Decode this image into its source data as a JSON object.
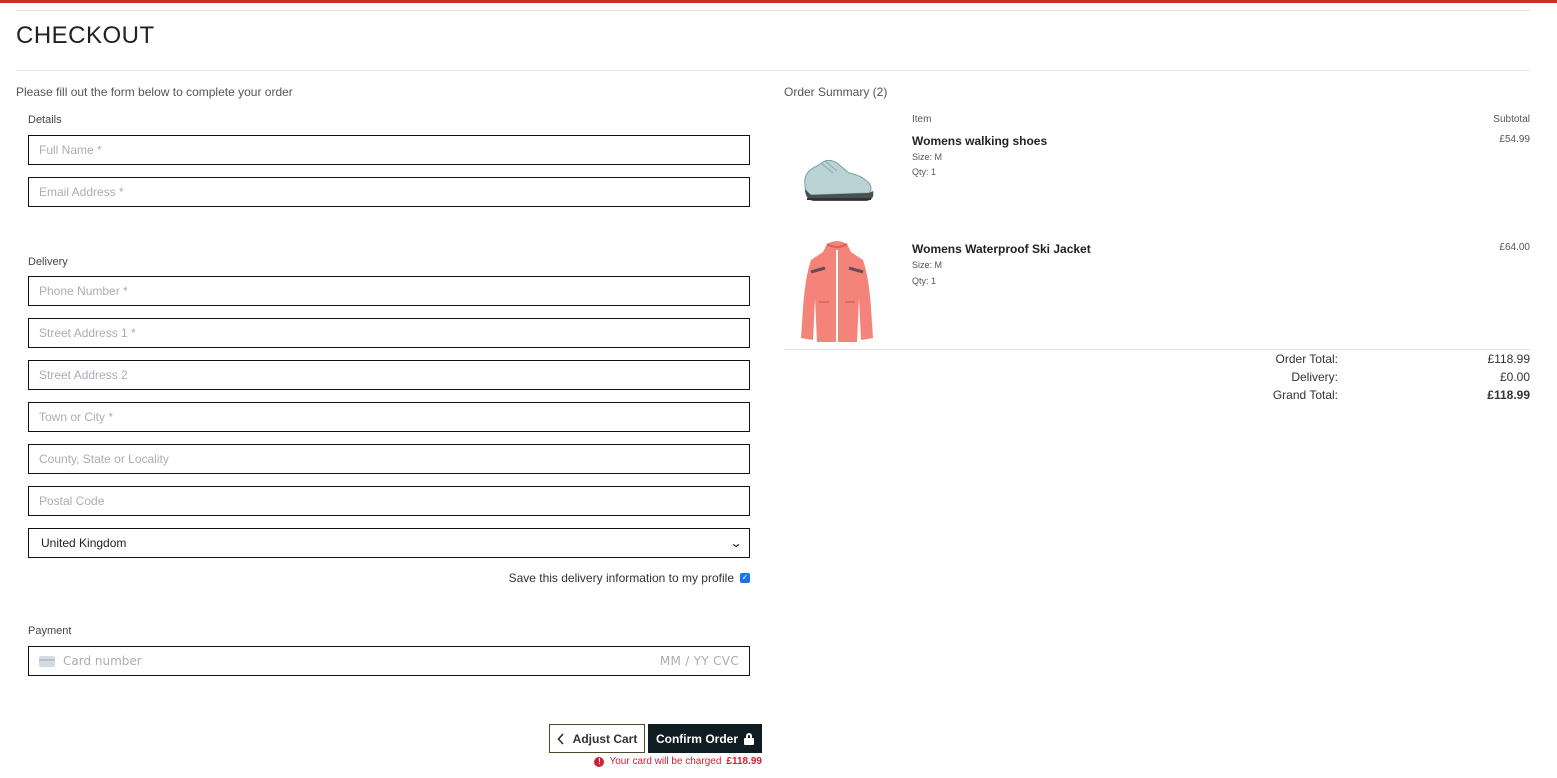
{
  "page": {
    "title": "CHECKOUT",
    "intro": "Please fill out the form below to complete your order"
  },
  "form": {
    "details_label": "Details",
    "full_name_placeholder": "Full Name *",
    "email_placeholder": "Email Address *",
    "delivery_label": "Delivery",
    "phone_placeholder": "Phone Number *",
    "street1_placeholder": "Street Address 1 *",
    "street2_placeholder": "Street Address 2",
    "town_placeholder": "Town or City *",
    "county_placeholder": "County, State or Locality",
    "postcode_placeholder": "Postal Code",
    "country_value": "United Kingdom",
    "save_info_label": "Save this delivery information to my profile",
    "save_info_checked": true,
    "payment_label": "Payment",
    "card_placeholder": "Card number",
    "card_right_placeholder": "MM / YY  CVC"
  },
  "actions": {
    "adjust_cart_label": "Adjust Cart",
    "confirm_order_label": "Confirm Order",
    "charge_note": "Your card will be charged",
    "charge_amount": "£118.99"
  },
  "summary": {
    "title": "Order Summary (2)",
    "col_item": "Item",
    "col_subtotal": "Subtotal",
    "items": [
      {
        "name": "Womens walking shoes",
        "size": "Size: M",
        "qty": "Qty: 1",
        "price": "£54.99"
      },
      {
        "name": "Womens Waterproof Ski Jacket",
        "size": "Size: M",
        "qty": "Qty: 1",
        "price": "£64.00"
      }
    ],
    "order_total_label": "Order Total:",
    "order_total": "£118.99",
    "delivery_label": "Delivery:",
    "delivery": "£0.00",
    "grand_total_label": "Grand Total:",
    "grand_total": "£118.99"
  },
  "colors": {
    "accent": "#c7321c",
    "confirm_bg": "#0f1c21",
    "error": "#d01f35",
    "jacket": "#f4837a",
    "shoe": "#b9d3d6"
  },
  "icons": {
    "adjust": "chevron-left-icon",
    "confirm": "lock-icon",
    "alert": "alert-circle-icon",
    "card": "credit-card-icon",
    "select": "chevron-down-icon"
  }
}
